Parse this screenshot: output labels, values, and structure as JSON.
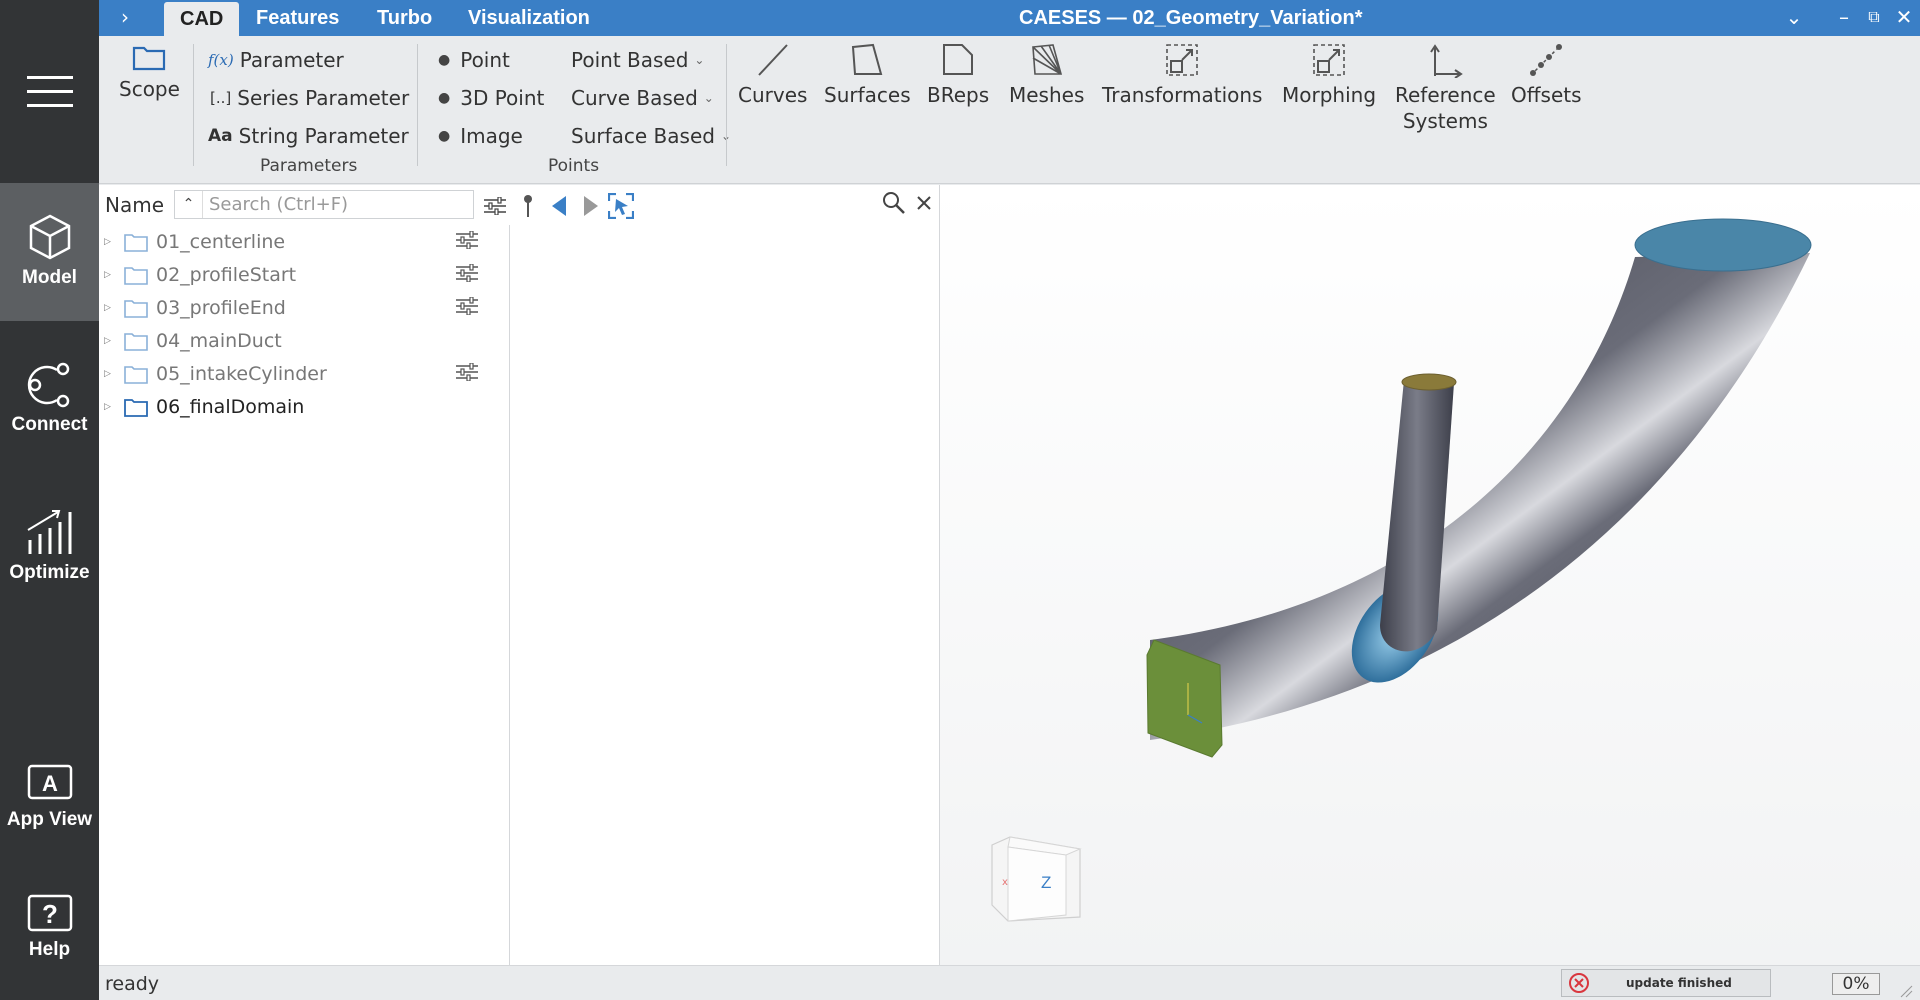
{
  "window": {
    "title": "CAESES — 02_Geometry_Variation*",
    "tabs": [
      {
        "label": "CAD"
      },
      {
        "label": "Features"
      },
      {
        "label": "Turbo"
      },
      {
        "label": "Visualization"
      }
    ],
    "expand_glyph": "›"
  },
  "sidebar": {
    "items": [
      {
        "label": "Model",
        "icon": "cube-icon",
        "active": true
      },
      {
        "label": "Connect",
        "icon": "connect-icon"
      },
      {
        "label": "Optimize",
        "icon": "optimize-chart-icon"
      },
      {
        "label": "App View",
        "icon": "app-view-icon"
      },
      {
        "label": "Help",
        "icon": "help-icon"
      }
    ]
  },
  "ribbon": {
    "scope": "Scope",
    "parameters": {
      "items": [
        {
          "prefix": "f(x)",
          "label": "Parameter"
        },
        {
          "prefix": "[..]",
          "label": "Series Parameter"
        },
        {
          "prefix": "Aa",
          "label": "String Parameter"
        }
      ],
      "group_label": "Parameters"
    },
    "points": {
      "items": [
        {
          "label": "Point"
        },
        {
          "label": "3D Point"
        },
        {
          "label": "Image"
        }
      ],
      "dropdowns": [
        {
          "label": "Point Based"
        },
        {
          "label": "Curve Based"
        },
        {
          "label": "Surface Based"
        }
      ],
      "group_label": "Points"
    },
    "big_buttons": [
      {
        "label": "Curves",
        "icon": "curve-line-icon"
      },
      {
        "label": "Surfaces",
        "icon": "surface-icon"
      },
      {
        "label": "BReps",
        "icon": "brep-icon"
      },
      {
        "label": "Meshes",
        "icon": "mesh-icon"
      },
      {
        "label": "Transformations",
        "icon": "transformation-icon"
      },
      {
        "label": "Morphing",
        "icon": "morphing-icon"
      },
      {
        "label": "Reference\nSystems",
        "icon": "reference-systems-icon"
      },
      {
        "label": "Offsets",
        "icon": "offsets-icon"
      }
    ]
  },
  "tree": {
    "header_name": "Name",
    "search_placeholder": "Search (Ctrl+F)",
    "rows": [
      {
        "label": "01_centerline",
        "has_options": true,
        "bold": false
      },
      {
        "label": "02_profileStart",
        "has_options": true,
        "bold": false
      },
      {
        "label": "03_profileEnd",
        "has_options": true,
        "bold": false
      },
      {
        "label": "04_mainDuct",
        "has_options": false,
        "bold": false
      },
      {
        "label": "05_intakeCylinder",
        "has_options": true,
        "bold": false
      },
      {
        "label": "06_finalDomain",
        "has_options": false,
        "bold": true
      }
    ]
  },
  "viewport": {
    "nav_cube_label": "Z"
  },
  "status": {
    "text": "ready",
    "update_text": "update finished",
    "progress": "0%"
  },
  "colors": {
    "accent": "#3a7fc6",
    "sidebar": "#323436",
    "sidebar_active": "#5c5f62",
    "duct_body": "#5a5c68",
    "duct_end_cap": "#4a86a8",
    "inlet_face": "#6b8f3a",
    "cylinder_cap": "#8a7a3a"
  }
}
